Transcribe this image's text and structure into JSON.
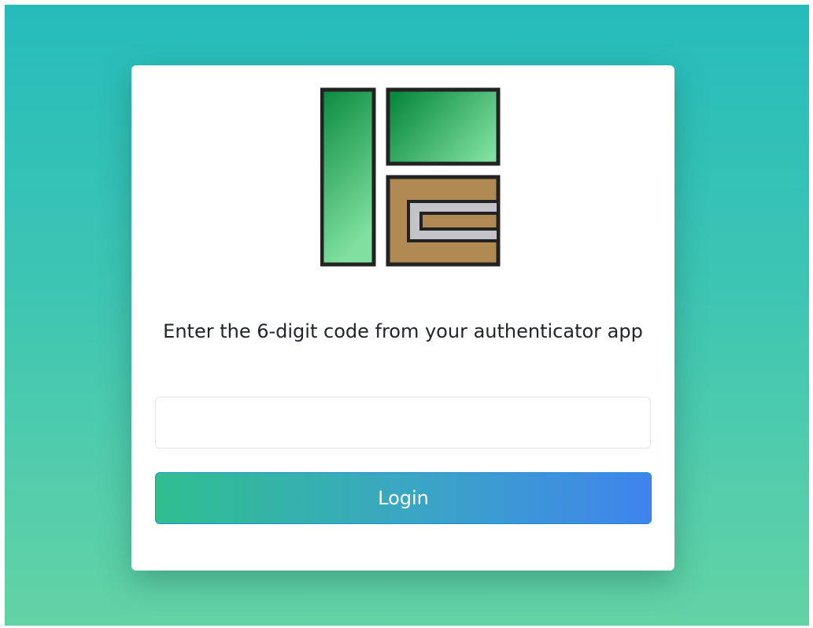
{
  "login": {
    "prompt": "Enter the 6-digit code from your authenticator app",
    "code_input_value": "",
    "code_input_placeholder": "",
    "button_label": "Login"
  },
  "branding": {
    "logo_icon": "app-logo-icon",
    "colors": {
      "green_dark": "#0a8a3e",
      "green_light": "#7fe0a0",
      "tan": "#b08a52",
      "grey": "#c3c3c8",
      "outline": "#222222"
    }
  },
  "theme": {
    "background_top": "#26bcbb",
    "background_bottom": "#63d3a5",
    "button_start": "#2fbf8e",
    "button_end": "#3f84ee"
  }
}
